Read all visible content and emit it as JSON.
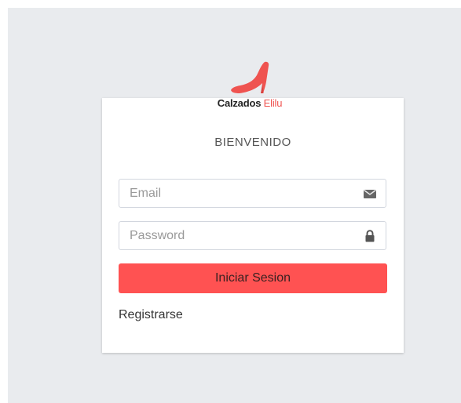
{
  "brand": {
    "name_primary": "Calzados",
    "name_secondary": "Elilu",
    "accent_color": "#ef5350",
    "logo_icon": "high-heel-shoe-icon"
  },
  "login": {
    "title": "BIENVENIDO",
    "email_placeholder": "Email",
    "email_value": "",
    "email_icon": "envelope-icon",
    "password_placeholder": "Password",
    "password_value": "",
    "password_icon": "lock-icon",
    "submit_label": "Iniciar Sesion",
    "submit_color": "#ff5252",
    "register_label": "Registrarse"
  }
}
